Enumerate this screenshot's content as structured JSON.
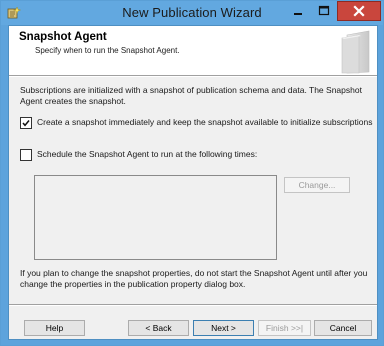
{
  "window": {
    "title": "New Publication Wizard"
  },
  "header": {
    "title": "Snapshot Agent",
    "subtitle": "Specify when to run the Snapshot Agent."
  },
  "body": {
    "intro": "Subscriptions are initialized with a snapshot of publication schema and data. The Snapshot Agent creates the snapshot.",
    "option_create": {
      "label": "Create a snapshot immediately and keep the snapshot available to initialize subscriptions",
      "checked": true
    },
    "option_schedule": {
      "label": "Schedule the Snapshot Agent to run at the following times:",
      "checked": false
    },
    "schedule_change_label": "Change...",
    "note": "If you plan to change the snapshot properties, do not start the Snapshot Agent until after you change the properties in the publication property dialog box."
  },
  "footer": {
    "help_label": "Help",
    "back_label": "< Back",
    "next_label": "Next >",
    "finish_label": "Finish >>|",
    "cancel_label": "Cancel"
  }
}
